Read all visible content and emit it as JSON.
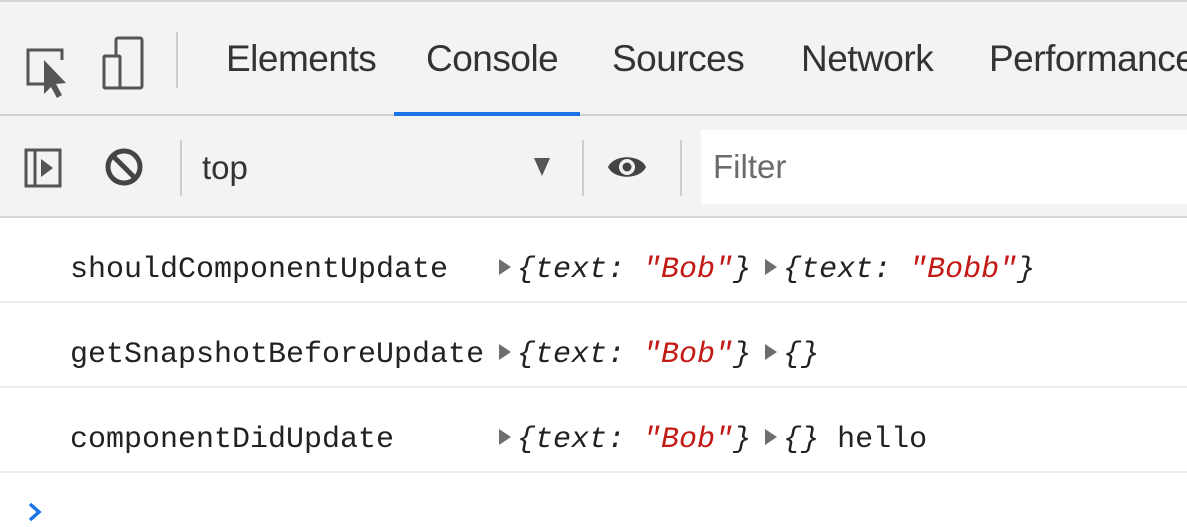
{
  "tabs": [
    {
      "label": "Elements"
    },
    {
      "label": "Console",
      "active": true
    },
    {
      "label": "Sources"
    },
    {
      "label": "Network"
    },
    {
      "label": "Performance"
    }
  ],
  "icons": {
    "inspect": "inspect-element-icon",
    "device": "device-toolbar-icon",
    "sidebar": "sidebar-toggle-icon",
    "clear": "clear-console-icon",
    "eye": "live-expression-eye-icon",
    "dropdown": "dropdown-arrow-icon",
    "expand": "expand-triangle-icon",
    "prompt": "console-prompt-icon"
  },
  "colors": {
    "accent": "#1a73e8",
    "string": "#c41a16",
    "prompt": "#1a73e8"
  },
  "toolbar": {
    "context": "top",
    "filter_placeholder": "Filter"
  },
  "messages": [
    {
      "name": "shouldComponentUpdate",
      "arg1": {
        "key": "text",
        "value": "\"Bob\""
      },
      "arg2": {
        "key": "text",
        "value": "\"Bobb\""
      }
    },
    {
      "name": "getSnapshotBeforeUpdate",
      "arg1": {
        "key": "text",
        "value": "\"Bob\""
      },
      "arg2": "{}"
    },
    {
      "name": "componentDidUpdate",
      "arg1": {
        "key": "text",
        "value": "\"Bob\""
      },
      "arg2": "{}",
      "extra": "hello"
    }
  ]
}
